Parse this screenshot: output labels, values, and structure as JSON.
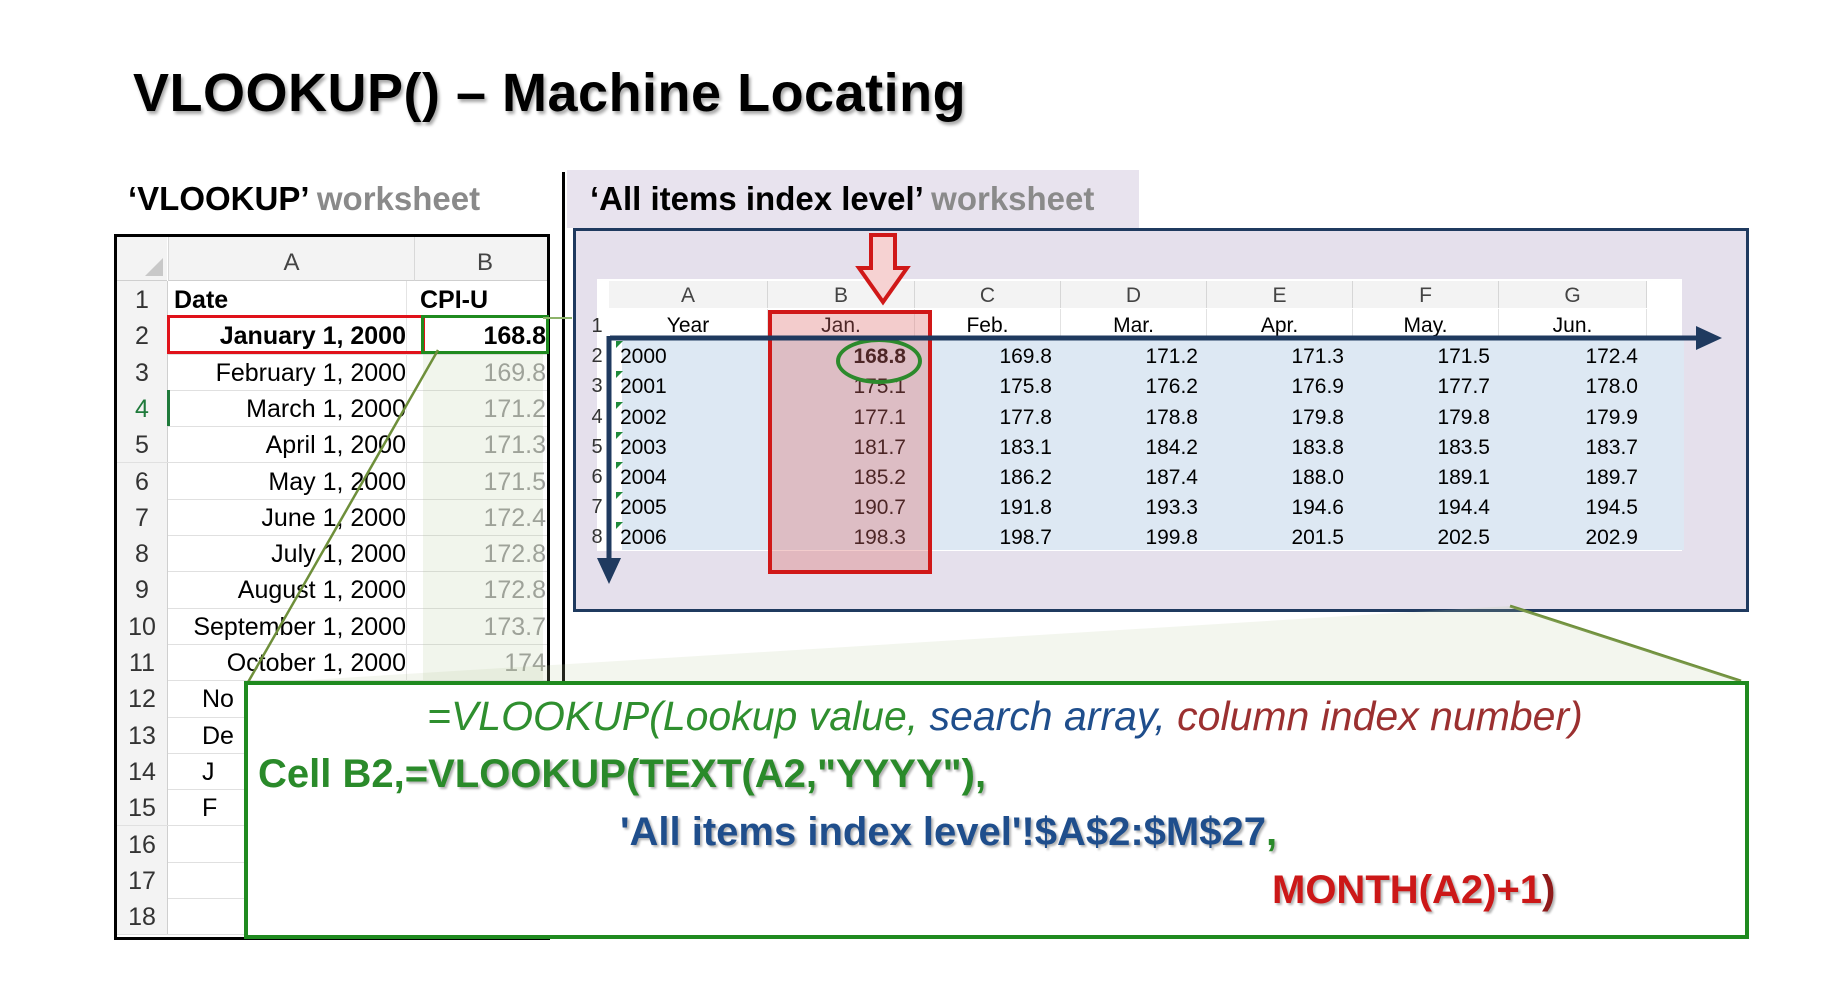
{
  "title": "VLOOKUP() – Machine Locating",
  "left_caption": {
    "name": "‘VLOOKUP’",
    "suffix": " worksheet"
  },
  "right_caption": {
    "name": "‘All items index level’",
    "suffix": " worksheet"
  },
  "left_sheet": {
    "col_headers": [
      "A",
      "B"
    ],
    "rows": [
      {
        "n": "1",
        "a": "Date",
        "b": "CPI-U"
      },
      {
        "n": "2",
        "a": "January 1, 2000",
        "b": "168.8"
      },
      {
        "n": "3",
        "a": "February 1, 2000",
        "b": "169.8"
      },
      {
        "n": "4",
        "a": "March 1, 2000",
        "b": "171.2"
      },
      {
        "n": "5",
        "a": "April 1, 2000",
        "b": "171.3"
      },
      {
        "n": "6",
        "a": "May 1, 2000",
        "b": "171.5"
      },
      {
        "n": "7",
        "a": "June 1, 2000",
        "b": "172.4"
      },
      {
        "n": "8",
        "a": "July 1, 2000",
        "b": "172.8"
      },
      {
        "n": "9",
        "a": "August 1, 2000",
        "b": "172.8"
      },
      {
        "n": "10",
        "a": "September 1, 2000",
        "b": "173.7"
      },
      {
        "n": "11",
        "a": "October 1, 2000",
        "b": "174"
      },
      {
        "n": "12",
        "a": "No",
        "b": ""
      },
      {
        "n": "13",
        "a": "De",
        "b": ""
      },
      {
        "n": "14",
        "a": "J",
        "b": ""
      },
      {
        "n": "15",
        "a": "F",
        "b": ""
      },
      {
        "n": "16",
        "a": "",
        "b": ""
      },
      {
        "n": "17",
        "a": "",
        "b": ""
      },
      {
        "n": "18",
        "a": "",
        "b": ""
      }
    ]
  },
  "right_sheet": {
    "col_headers": [
      "A",
      "B",
      "C",
      "D",
      "E",
      "F",
      "G"
    ],
    "header_row": [
      "Year",
      "Jan.",
      "Feb.",
      "Mar.",
      "Apr.",
      "May.",
      "Jun."
    ],
    "row_numbers": [
      "1",
      "2",
      "3",
      "4",
      "5",
      "6",
      "7",
      "8"
    ],
    "rows": [
      {
        "year": "2000",
        "vals": [
          "168.8",
          "169.8",
          "171.2",
          "171.3",
          "171.5",
          "172.4"
        ]
      },
      {
        "year": "2001",
        "vals": [
          "175.1",
          "175.8",
          "176.2",
          "176.9",
          "177.7",
          "178.0"
        ]
      },
      {
        "year": "2002",
        "vals": [
          "177.1",
          "177.8",
          "178.8",
          "179.8",
          "179.8",
          "179.9"
        ]
      },
      {
        "year": "2003",
        "vals": [
          "181.7",
          "183.1",
          "184.2",
          "183.8",
          "183.5",
          "183.7"
        ]
      },
      {
        "year": "2004",
        "vals": [
          "185.2",
          "186.2",
          "187.4",
          "188.0",
          "189.1",
          "189.7"
        ]
      },
      {
        "year": "2005",
        "vals": [
          "190.7",
          "191.8",
          "193.3",
          "194.6",
          "194.4",
          "194.5"
        ]
      },
      {
        "year": "2006",
        "vals": [
          "198.3",
          "198.7",
          "199.8",
          "201.5",
          "202.5",
          "202.9"
        ]
      }
    ]
  },
  "formula": {
    "generic_prefix": "=VLOOKUP(Lookup value, ",
    "generic_array": "search array, ",
    "generic_col": "column  index number)",
    "line1_cell": "Cell B2,",
    "line1_formula": "=VLOOKUP(TEXT(A2,\"YYYY\"),",
    "line2": "'All items index level'!$A$2:$M$27",
    "line2_end": ",",
    "line3": "MONTH(A2)+1",
    "line3_end": ")"
  },
  "colors": {
    "green": "#1f8a1f",
    "red": "#d01818",
    "navy": "#1f3a5f",
    "blue_text": "#1f4e8c",
    "lavender": "#e5e0ec"
  }
}
